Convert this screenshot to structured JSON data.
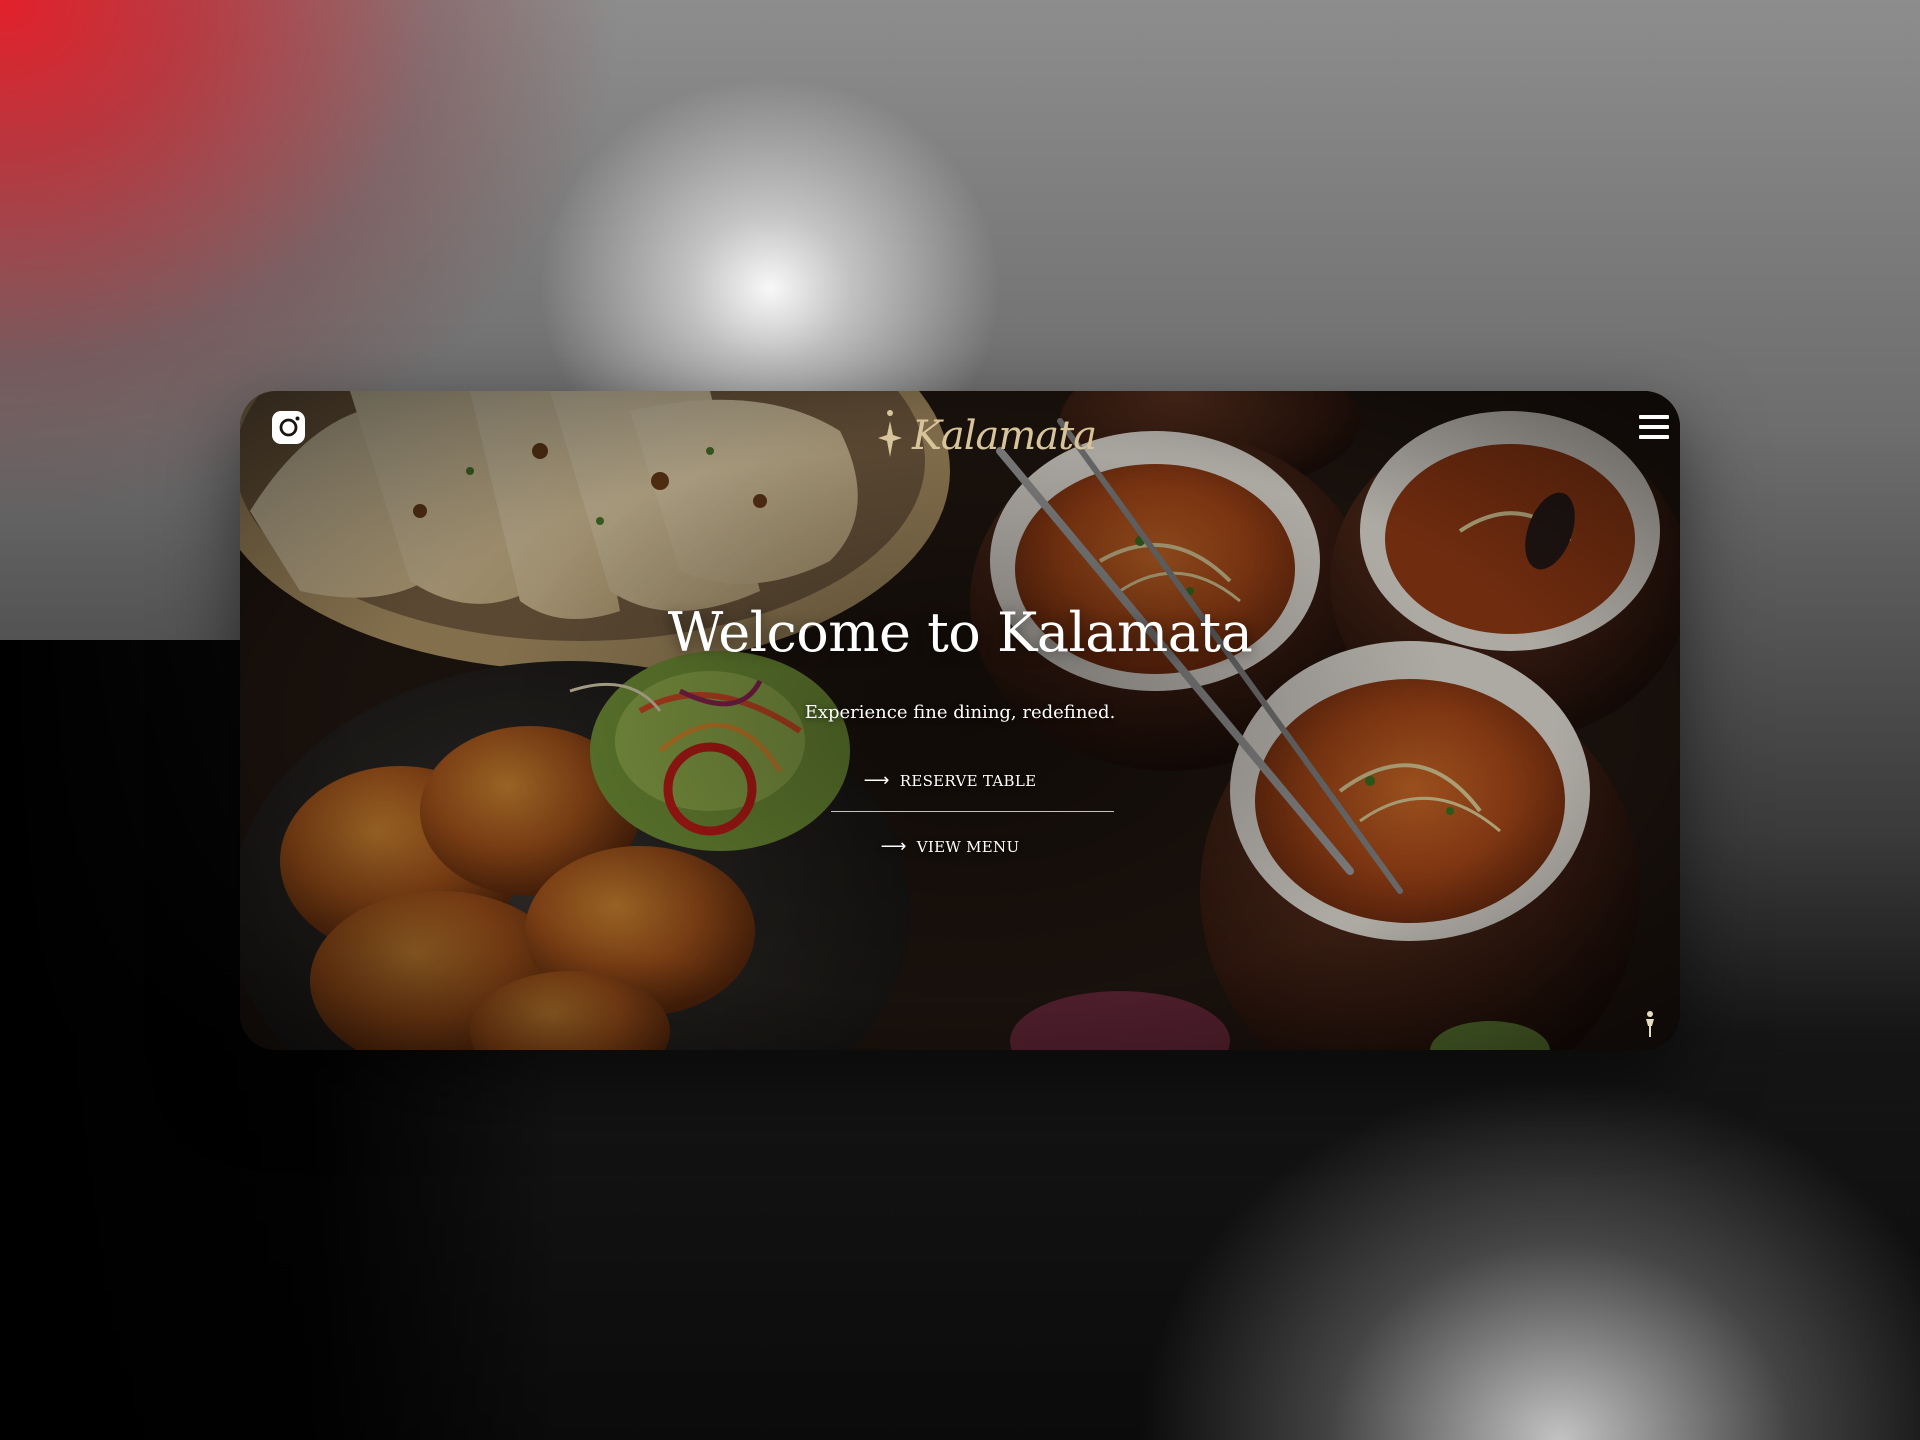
{
  "header": {
    "social_icon": "instagram-icon",
    "logo_text": "Kalamata",
    "menu_icon": "hamburger-menu-icon"
  },
  "hero": {
    "title": "Welcome to Kalamata",
    "subtitle": "Experience fine dining, redefined.",
    "primary_cta": {
      "label": "RESERVE TABLE",
      "icon": "arrow-right-icon"
    },
    "secondary_cta": {
      "label": "VIEW MENU",
      "icon": "arrow-right-icon"
    }
  },
  "colors": {
    "text": "#ffffff",
    "logo_gold": "#d8c49a",
    "backdrop_red": "#e3202a",
    "card_dark": "#1b130e"
  }
}
